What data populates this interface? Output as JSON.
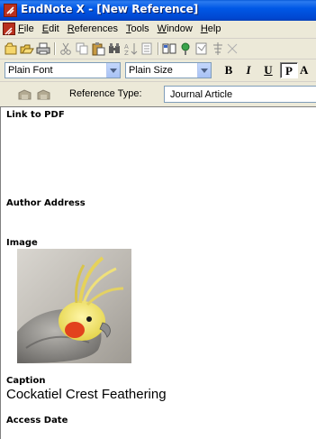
{
  "window": {
    "title": "EndNote X - [New Reference]"
  },
  "menu": {
    "items": [
      {
        "accel": "F",
        "rest": "ile"
      },
      {
        "accel": "E",
        "rest": "dit"
      },
      {
        "accel": "R",
        "rest": "eferences"
      },
      {
        "accel": "T",
        "rest": "ools"
      },
      {
        "accel": "W",
        "rest": "indow"
      },
      {
        "accel": "H",
        "rest": "elp"
      }
    ]
  },
  "toolbar": {
    "icons": [
      "new-reference-icon",
      "open-library-icon",
      "print-icon",
      "cut-icon",
      "copy-icon",
      "paste-icon",
      "find-icon",
      "sort-icon",
      "show-all-icon",
      "copy-formatted-icon",
      "online-search-icon",
      "insert-citation-icon",
      "format-bibliography-icon"
    ]
  },
  "format": {
    "font": "Plain Font",
    "size": "Plain Size",
    "bold": "B",
    "italic": "I",
    "underline": "U",
    "plain": "P",
    "more": "A"
  },
  "reference": {
    "type_label": "Reference Type:",
    "type_value": "Journal Article"
  },
  "fields": {
    "link_to_pdf": {
      "label": "Link to PDF"
    },
    "author_address": {
      "label": "Author Address"
    },
    "image": {
      "label": "Image"
    },
    "caption": {
      "label": "Caption",
      "value": "Cockatiel Crest Feathering"
    },
    "access_date": {
      "label": "Access Date"
    }
  },
  "colors": {
    "titlebar": "#0058e6",
    "chrome": "#ece9d8",
    "content_bg": "#ffffff",
    "field_label": "#000000"
  }
}
